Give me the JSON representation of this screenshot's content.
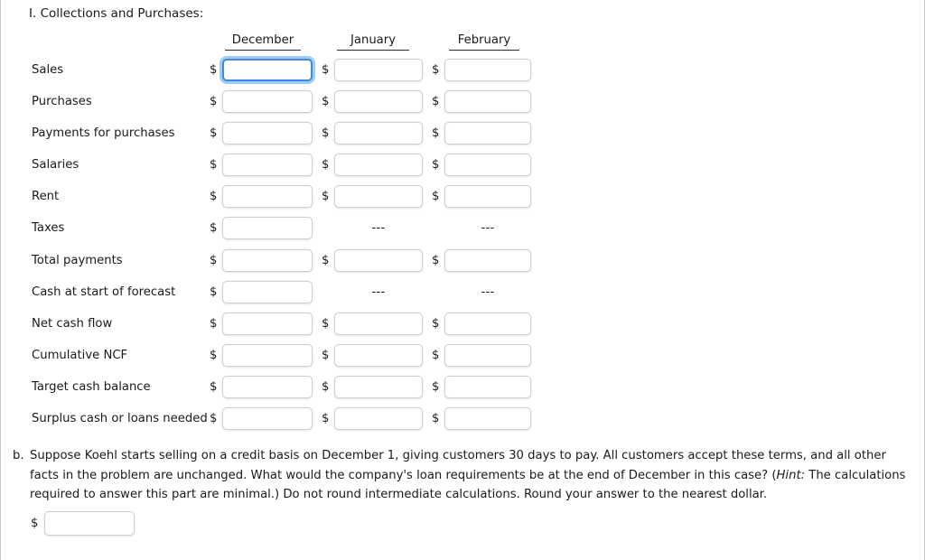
{
  "section": {
    "title": "I. Collections and Purchases:"
  },
  "columns": [
    {
      "label": "December"
    },
    {
      "label": "January"
    },
    {
      "label": "February"
    }
  ],
  "currency_symbol": "$",
  "na_marker": "---",
  "rows": [
    {
      "label": "Sales",
      "cells": [
        "input",
        "input",
        "input"
      ],
      "value": "",
      "focused": true
    },
    {
      "label": "Purchases",
      "cells": [
        "input",
        "input",
        "input"
      ],
      "value": "",
      "focused": false
    },
    {
      "label": "Payments for purchases",
      "cells": [
        "input",
        "input",
        "input"
      ],
      "value": "",
      "focused": false
    },
    {
      "label": "Salaries",
      "cells": [
        "input",
        "input",
        "input"
      ],
      "value": "",
      "focused": false
    },
    {
      "label": "Rent",
      "cells": [
        "input",
        "input",
        "input"
      ],
      "value": "",
      "focused": false
    },
    {
      "label": "Taxes",
      "cells": [
        "input",
        "na",
        "na"
      ],
      "value": "",
      "focused": false
    },
    {
      "label": "Total payments",
      "cells": [
        "input",
        "input",
        "input"
      ],
      "value": "",
      "focused": false
    },
    {
      "label": "Cash at start of forecast",
      "cells": [
        "input",
        "na",
        "na"
      ],
      "value": "",
      "focused": false
    },
    {
      "label": "Net cash flow",
      "cells": [
        "input",
        "input",
        "input"
      ],
      "value": "",
      "focused": false
    },
    {
      "label": "Cumulative NCF",
      "cells": [
        "input",
        "input",
        "input"
      ],
      "value": "",
      "focused": false
    },
    {
      "label": "Target cash balance",
      "cells": [
        "input",
        "input",
        "input"
      ],
      "value": "",
      "focused": false
    },
    {
      "label": "Surplus cash or loans needed",
      "cells": [
        "input",
        "input",
        "input"
      ],
      "value": "",
      "focused": false
    }
  ],
  "part_b": {
    "marker": "b.",
    "text_before_hint": "Suppose Koehl starts selling on a credit basis on December 1, giving customers 30 days to pay. All customers accept these terms, and all other facts in the problem are unchanged. What would the company's loan requirements be at the end of December in this case? (",
    "hint_label": "Hint:",
    "text_after_hint": " The calculations required to answer this part are minimal.) Do not round intermediate calculations. Round your answer to the nearest dollar.",
    "answer_value": ""
  },
  "theme": {
    "focus_border": "#3c89e8",
    "focus_glow": "rgba(93,160,232,0.55)",
    "input_border": "#cfcfcf",
    "text": "#1a1a1a",
    "page_border": "#c9c9c9",
    "background": "#ffffff"
  }
}
